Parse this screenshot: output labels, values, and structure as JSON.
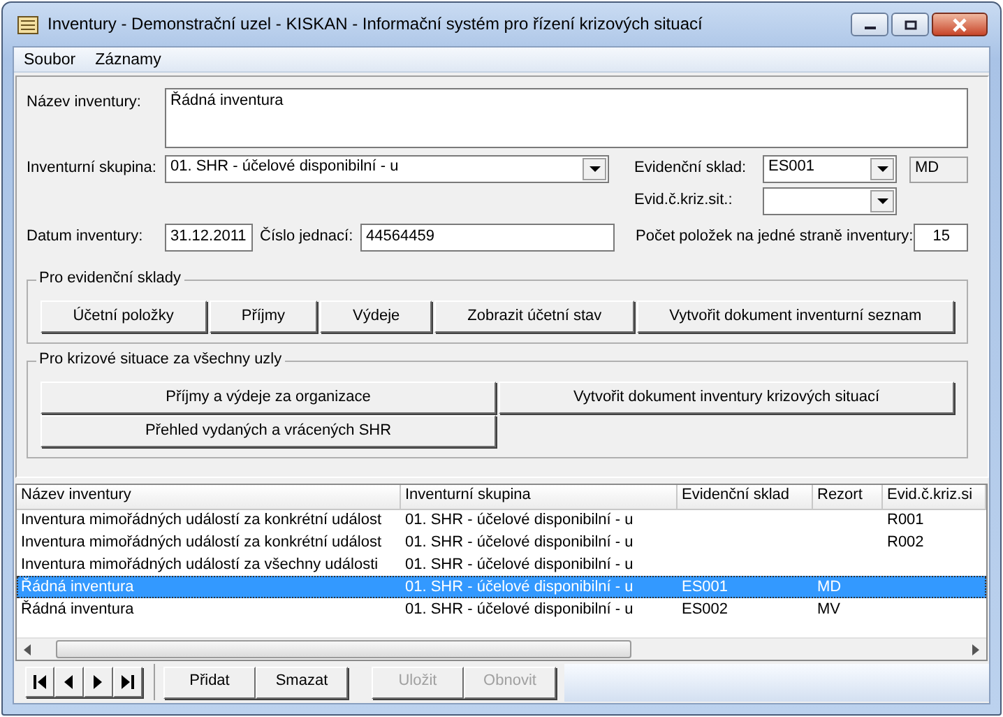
{
  "window": {
    "title": "Inventury - Demonstrační uzel - KISKAN - Informační systém pro řízení krizových situací"
  },
  "menu": [
    {
      "label": "Soubor"
    },
    {
      "label": "Záznamy"
    }
  ],
  "form": {
    "name": {
      "label": "Název inventury:",
      "value": "Řádná inventura"
    },
    "group": {
      "label": "Inventurní skupina:",
      "value": "01. SHR - účelové disponibilní - u"
    },
    "warehouse": {
      "label": "Evidenční sklad:",
      "value": "ES001"
    },
    "rezort": {
      "value": "MD"
    },
    "crisis": {
      "label": "Evid.č.kriz.sit.:"
    },
    "date": {
      "label": "Datum inventury:",
      "value": "31.12.2011"
    },
    "reference": {
      "label": "Číslo jednací:",
      "value": "44564459"
    },
    "page_size": {
      "label": "Počet položek na jedné straně inventury:",
      "value": "15"
    }
  },
  "groups": [
    {
      "title": "Pro evidenční sklady",
      "kind": "row",
      "buttons": [
        "Účetní položky",
        "Příjmy",
        "Výdeje",
        "Zobrazit účetní stav",
        "Vytvořit dokument inventurní seznam"
      ]
    },
    {
      "title": "Pro krizové situace za všechny uzly",
      "kind": "grid",
      "buttons": [
        "Příjmy a výdeje za organizace",
        "Vytvořit dokument inventury krizových situací",
        "Přehled vydaných a vrácených SHR"
      ]
    }
  ],
  "table": {
    "columns": [
      "Název inventury",
      "Inventurní skupina",
      "Evidenční sklad",
      "Rezort",
      "Evid.č.kriz.si"
    ],
    "rows": [
      {
        "name": "Inventura mimořádných událostí za konkrétní událost",
        "group": "01. SHR - účelové disponibilní - u",
        "crisis": "R001",
        "selected": false
      },
      {
        "name": "Inventura mimořádných událostí za konkrétní událost",
        "group": "01. SHR - účelové disponibilní - u",
        "crisis": "R002",
        "selected": false
      },
      {
        "name": "Inventura mimořádných událostí za všechny události",
        "group": "01. SHR - účelové disponibilní - u",
        "selected": false
      },
      {
        "name": "Řádná inventura",
        "group": "01. SHR - účelové disponibilní - u",
        "warehouse": "ES001",
        "rezort": "MD",
        "selected": true
      },
      {
        "name": "Řádná inventura",
        "group": "01. SHR - účelové disponibilní - u",
        "warehouse": "ES002",
        "rezort": "MV",
        "selected": false
      }
    ]
  },
  "actions": [
    {
      "label": "Přidat",
      "disabled": false
    },
    {
      "label": "Smazat",
      "disabled": false
    },
    {
      "label": "Uložit",
      "disabled": true
    },
    {
      "label": "Obnovit",
      "disabled": true
    }
  ]
}
